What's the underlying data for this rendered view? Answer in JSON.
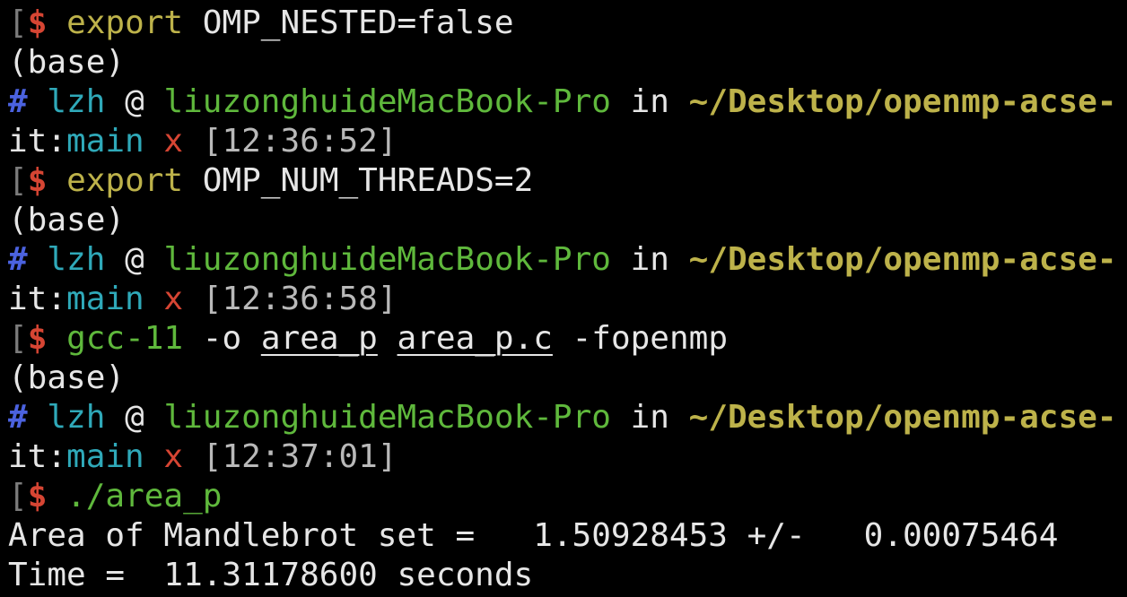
{
  "colors": {
    "background": "#000000",
    "text": "#e6e6e6",
    "prompt_dollar": "#d64533",
    "command": "#bdb24a",
    "user": "#4b62df",
    "host": "#5fb83c",
    "path": "#bdb24a",
    "branch": "#2fa9b9",
    "dirty_marker": "#d64533"
  },
  "lines": [
    {
      "segments": [
        {
          "text": "[",
          "cls": "c-bracket"
        },
        {
          "text": "$",
          "cls": "c-red bold"
        },
        {
          "text": " ",
          "cls": "c-white"
        },
        {
          "text": "export",
          "cls": "c-yellow"
        },
        {
          "text": " OMP_NESTED=false",
          "cls": "c-white"
        }
      ]
    },
    {
      "segments": [
        {
          "text": "(base)",
          "cls": "c-white"
        }
      ]
    },
    {
      "segments": [
        {
          "text": "#",
          "cls": "c-blue bold"
        },
        {
          "text": " ",
          "cls": "c-white"
        },
        {
          "text": "lzh",
          "cls": "c-cyan"
        },
        {
          "text": " @ ",
          "cls": "c-white"
        },
        {
          "text": "liuzonghuideMacBook-Pro",
          "cls": "c-green"
        },
        {
          "text": " in ",
          "cls": "c-white"
        },
        {
          "text": "~/Desktop/openmp-acse-",
          "cls": "c-yellow bold"
        }
      ]
    },
    {
      "segments": [
        {
          "text": "it:",
          "cls": "c-white"
        },
        {
          "text": "main",
          "cls": "c-cyan"
        },
        {
          "text": " ",
          "cls": "c-white"
        },
        {
          "text": "x",
          "cls": "c-red"
        },
        {
          "text": " [12:36:52]",
          "cls": "c-gray"
        }
      ]
    },
    {
      "segments": [
        {
          "text": "[",
          "cls": "c-bracket"
        },
        {
          "text": "$",
          "cls": "c-red bold"
        },
        {
          "text": " ",
          "cls": "c-white"
        },
        {
          "text": "export",
          "cls": "c-yellow"
        },
        {
          "text": " OMP_NUM_THREADS=2",
          "cls": "c-white"
        }
      ]
    },
    {
      "segments": [
        {
          "text": "(base)",
          "cls": "c-white"
        }
      ]
    },
    {
      "segments": [
        {
          "text": "#",
          "cls": "c-blue bold"
        },
        {
          "text": " ",
          "cls": "c-white"
        },
        {
          "text": "lzh",
          "cls": "c-cyan"
        },
        {
          "text": " @ ",
          "cls": "c-white"
        },
        {
          "text": "liuzonghuideMacBook-Pro",
          "cls": "c-green"
        },
        {
          "text": " in ",
          "cls": "c-white"
        },
        {
          "text": "~/Desktop/openmp-acse-",
          "cls": "c-yellow bold"
        }
      ]
    },
    {
      "segments": [
        {
          "text": "it:",
          "cls": "c-white"
        },
        {
          "text": "main",
          "cls": "c-cyan"
        },
        {
          "text": " ",
          "cls": "c-white"
        },
        {
          "text": "x",
          "cls": "c-red"
        },
        {
          "text": " [12:36:58]",
          "cls": "c-gray"
        }
      ]
    },
    {
      "segments": [
        {
          "text": "[",
          "cls": "c-bracket"
        },
        {
          "text": "$",
          "cls": "c-red bold"
        },
        {
          "text": " ",
          "cls": "c-white"
        },
        {
          "text": "gcc-11",
          "cls": "c-green"
        },
        {
          "text": " -o ",
          "cls": "c-white"
        },
        {
          "text": "area_p",
          "cls": "c-white u"
        },
        {
          "text": " ",
          "cls": "c-white"
        },
        {
          "text": "area_p.c",
          "cls": "c-white u"
        },
        {
          "text": " -fopenmp",
          "cls": "c-white"
        }
      ]
    },
    {
      "segments": [
        {
          "text": "(base)",
          "cls": "c-white"
        }
      ]
    },
    {
      "segments": [
        {
          "text": "#",
          "cls": "c-blue bold"
        },
        {
          "text": " ",
          "cls": "c-white"
        },
        {
          "text": "lzh",
          "cls": "c-cyan"
        },
        {
          "text": " @ ",
          "cls": "c-white"
        },
        {
          "text": "liuzonghuideMacBook-Pro",
          "cls": "c-green"
        },
        {
          "text": " in ",
          "cls": "c-white"
        },
        {
          "text": "~/Desktop/openmp-acse-",
          "cls": "c-yellow bold"
        }
      ]
    },
    {
      "segments": [
        {
          "text": "it:",
          "cls": "c-white"
        },
        {
          "text": "main",
          "cls": "c-cyan"
        },
        {
          "text": " ",
          "cls": "c-white"
        },
        {
          "text": "x",
          "cls": "c-red"
        },
        {
          "text": " [12:37:01]",
          "cls": "c-gray"
        }
      ]
    },
    {
      "segments": [
        {
          "text": "[",
          "cls": "c-bracket"
        },
        {
          "text": "$",
          "cls": "c-red bold"
        },
        {
          "text": " ",
          "cls": "c-white"
        },
        {
          "text": "./area_p",
          "cls": "c-green"
        }
      ]
    },
    {
      "segments": [
        {
          "text": "Area of Mandlebrot set =   1.50928453 +/-   0.00075464",
          "cls": "c-white"
        }
      ]
    },
    {
      "segments": [
        {
          "text": "Time =  11.31178600 seconds",
          "cls": "c-white"
        }
      ]
    }
  ]
}
